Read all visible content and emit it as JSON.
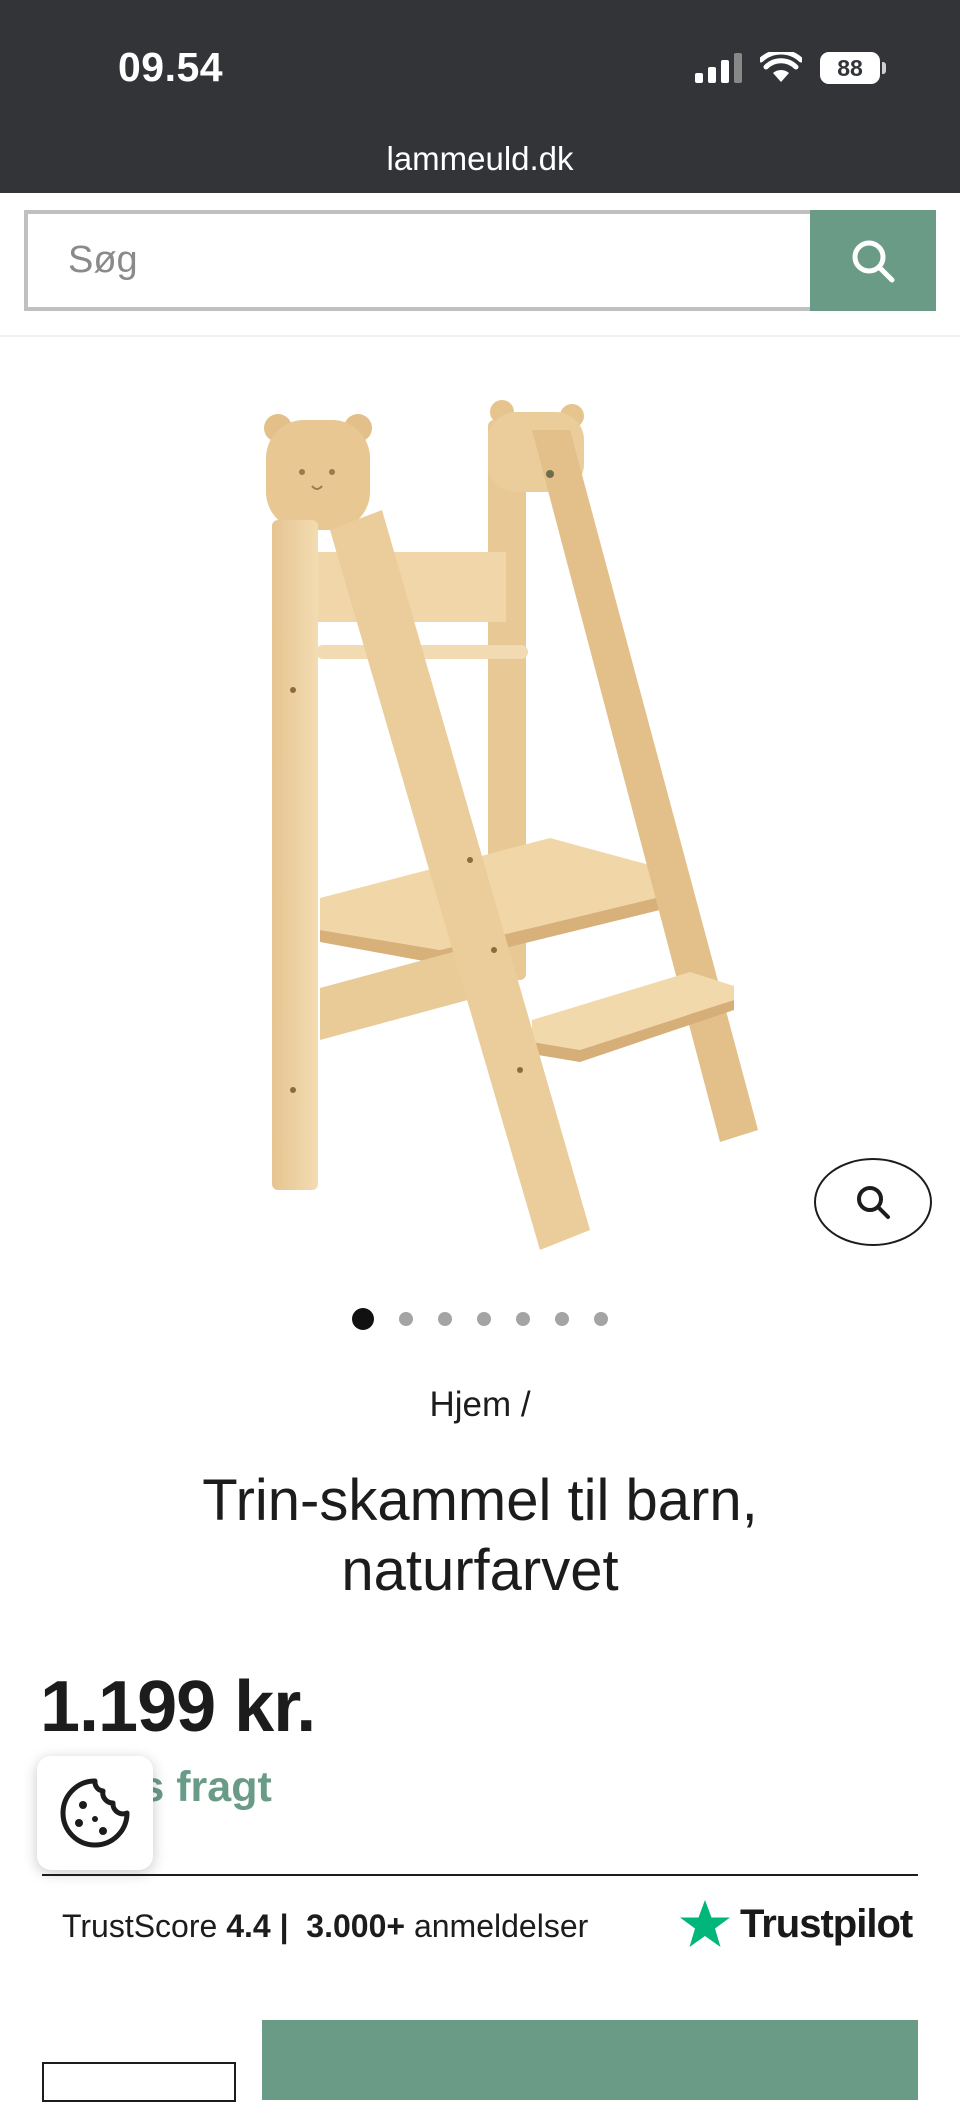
{
  "status_bar": {
    "time": "09.54",
    "battery": "88"
  },
  "browser": {
    "url": "lammeuld.dk"
  },
  "search": {
    "placeholder": "Søg"
  },
  "product": {
    "image_count": 7,
    "active_image": 1,
    "breadcrumb": "Hjem /",
    "title": "Trin-skammel til barn, naturfarvet",
    "price": "1.199 kr.",
    "shipping": "Gratis fragt"
  },
  "trust": {
    "label": "TrustScore",
    "score": "4.4",
    "separator": "|",
    "count": "3.000+",
    "reviews_label": "anmeldelser",
    "brand": "Trustpilot"
  },
  "colors": {
    "accent": "#6a9b87",
    "topbar": "#323437",
    "trustpilot_star": "#00b67a"
  }
}
